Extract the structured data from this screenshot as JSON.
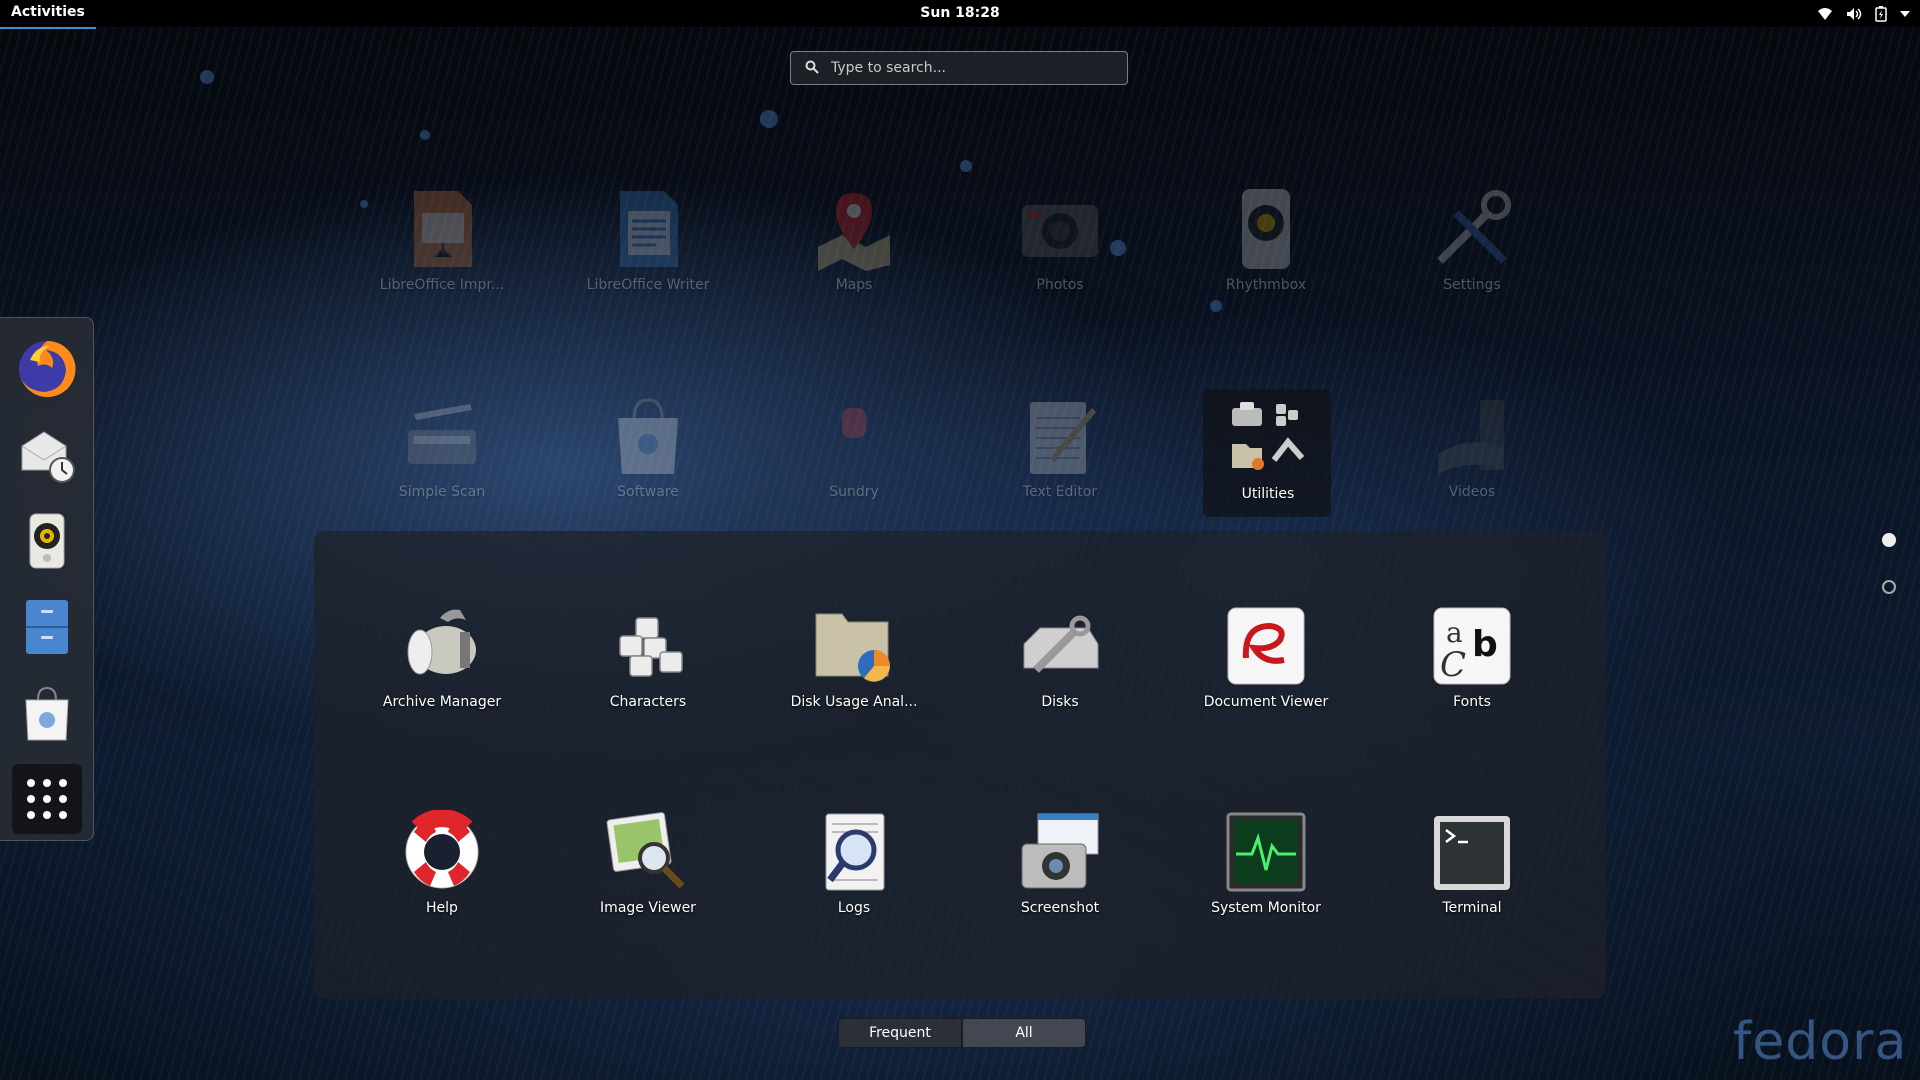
{
  "topbar": {
    "activities": "Activities",
    "clock": "Sun 18:28"
  },
  "tray_icons": [
    "wifi-icon",
    "volume-icon",
    "battery-icon",
    "menu-arrow-icon"
  ],
  "search": {
    "placeholder": "Type to search..."
  },
  "dash": {
    "items": [
      {
        "name": "Firefox",
        "icon": "firefox-icon"
      },
      {
        "name": "Evolution",
        "icon": "mail-clock-icon"
      },
      {
        "name": "Rhythmbox",
        "icon": "speaker-icon"
      },
      {
        "name": "Files",
        "icon": "file-cabinet-icon"
      },
      {
        "name": "Software",
        "icon": "shopping-bag-icon"
      },
      {
        "name": "Show Applications",
        "icon": "app-grid-icon"
      }
    ]
  },
  "apps_row1": [
    {
      "label": "LibreOffice Impr..."
    },
    {
      "label": "LibreOffice Writer"
    },
    {
      "label": "Maps"
    },
    {
      "label": "Photos"
    },
    {
      "label": "Rhythmbox"
    },
    {
      "label": "Settings"
    }
  ],
  "apps_row2": [
    {
      "label": "Simple Scan"
    },
    {
      "label": "Software"
    },
    {
      "label": "Sundry"
    },
    {
      "label": "Text Editor"
    },
    {
      "label": "Utilities"
    },
    {
      "label": "Videos"
    }
  ],
  "folder": {
    "name": "Utilities",
    "apps": [
      {
        "label": "Archive Manager"
      },
      {
        "label": "Characters"
      },
      {
        "label": "Disk Usage Anal..."
      },
      {
        "label": "Disks"
      },
      {
        "label": "Document Viewer"
      },
      {
        "label": "Fonts"
      },
      {
        "label": "Help"
      },
      {
        "label": "Image Viewer"
      },
      {
        "label": "Logs"
      },
      {
        "label": "Screenshot"
      },
      {
        "label": "System Monitor"
      },
      {
        "label": "Terminal"
      }
    ]
  },
  "view_switch": {
    "frequent": "Frequent",
    "all": "All",
    "active": "All"
  },
  "pages": {
    "count": 2,
    "current": 1
  },
  "branding": {
    "text": "fedora"
  },
  "colors": {
    "accent": "#3a8fd8",
    "panel": "#000000"
  }
}
